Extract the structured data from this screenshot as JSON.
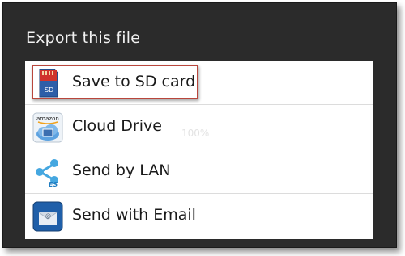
{
  "dialog": {
    "title": "Export this file",
    "overlay_text": "100%"
  },
  "options": [
    {
      "label": "Save to SD card",
      "icon": "sd-card-icon",
      "icon_text": "SD"
    },
    {
      "label": "Cloud Drive",
      "icon": "amazon-cloud-drive-icon",
      "icon_text": "amazon"
    },
    {
      "label": "Send by LAN",
      "icon": "share-lan-icon",
      "icon_text": "ES"
    },
    {
      "label": "Send with Email",
      "icon": "email-icon",
      "icon_text": "@"
    }
  ],
  "colors": {
    "dialog_bg": "#2b2b2b",
    "highlight_border": "#b9463c"
  }
}
